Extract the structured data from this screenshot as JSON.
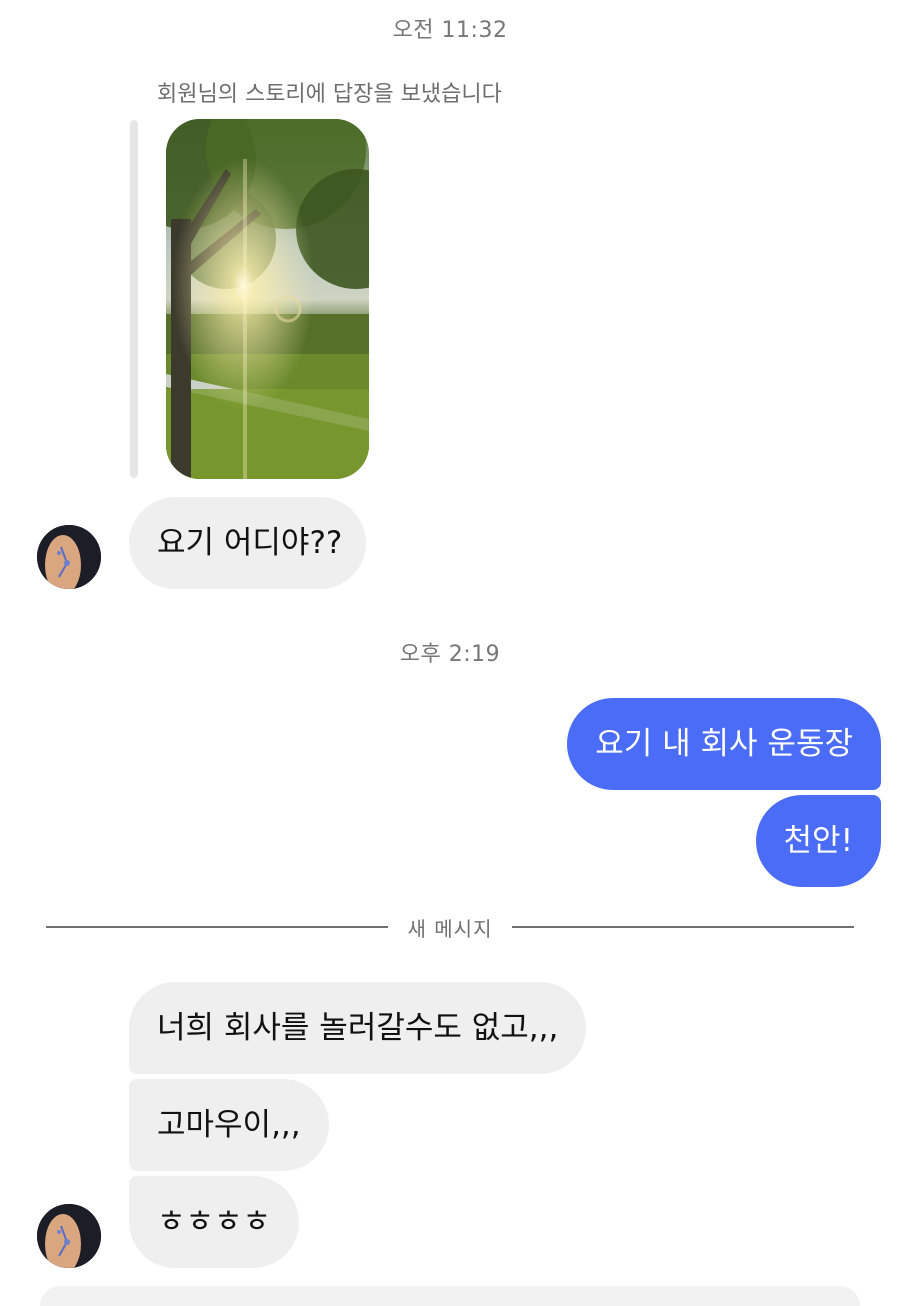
{
  "timestamps": {
    "morning": "오전 11:32",
    "afternoon": "오후 2:19"
  },
  "story_reply": {
    "caption": "회원님의 스토리에 답장을 보냈습니다"
  },
  "messages": [
    {
      "text": "요기 어디야??"
    },
    {
      "text": "요기 내 회사 운동장"
    },
    {
      "text": "천안!"
    },
    {
      "text": "너희 회사를 놀러갈수도 없고,,,"
    },
    {
      "text": "고마우이,,,"
    },
    {
      "text": "ㅎㅎㅎㅎ"
    }
  ],
  "new_messages_divider": "새 메시지",
  "colors": {
    "outgoing": "#4a6cf7",
    "incoming": "#efefef",
    "timestamp": "#777777"
  },
  "icons": {
    "avatar": "user-avatar-tattoo"
  }
}
